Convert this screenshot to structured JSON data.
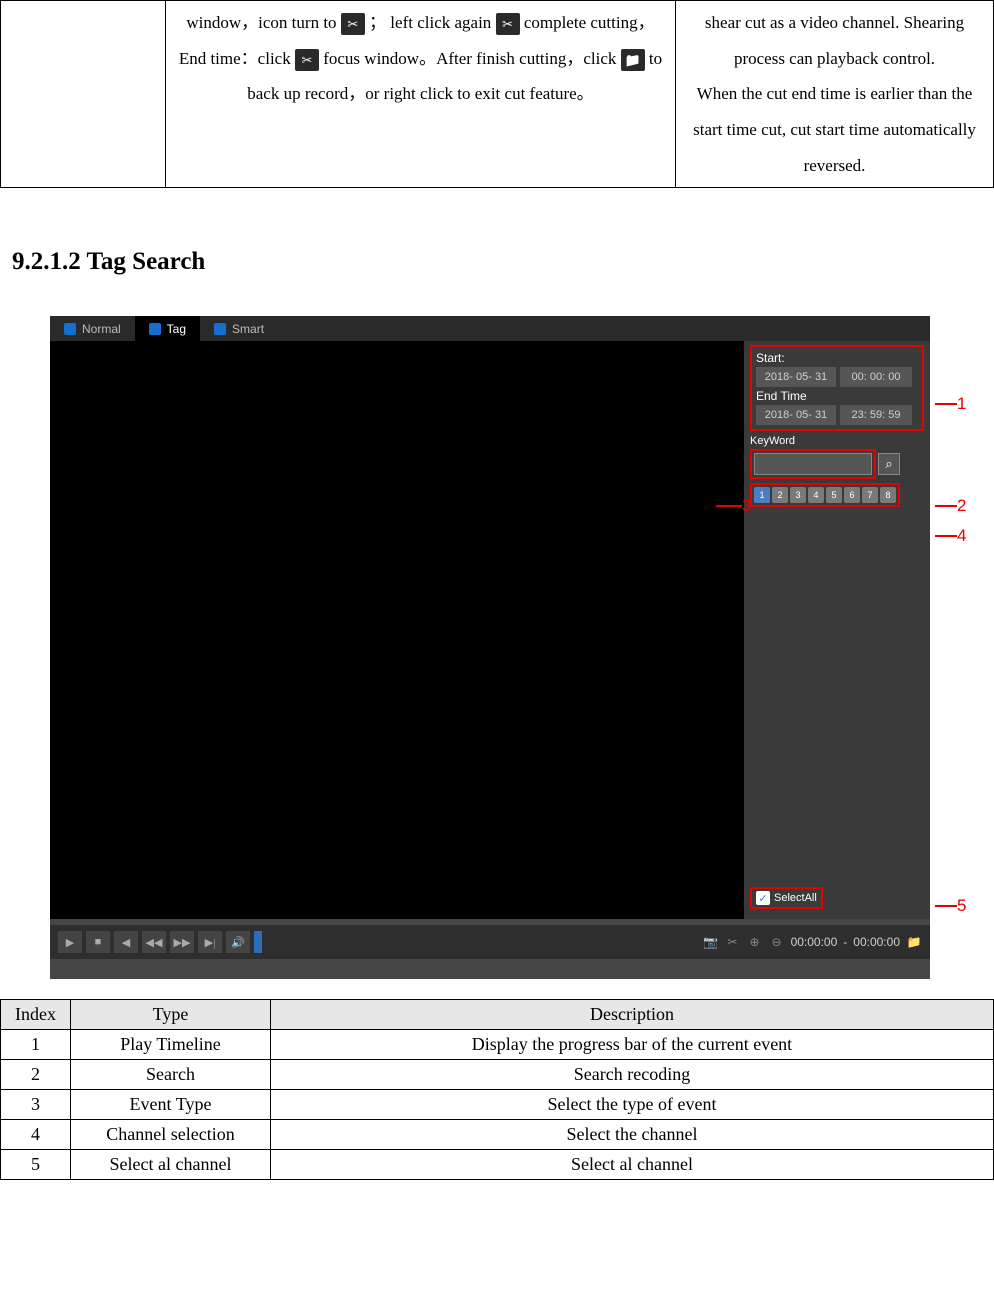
{
  "top_table": {
    "col2_parts": {
      "p1": "window，icon turn to ",
      "p2": "； left click again",
      "p3": "complete cutting，",
      "p4": "End time：click",
      "p5": "focus window。After finish cutting，click",
      "p6": "to back up record，or right click to exit cut feature。"
    },
    "col3": "shear cut as a video channel. Shearing process can playback control.\nWhen the cut end time is earlier than the start time cut, cut start time automatically reversed."
  },
  "heading": "9.2.1.2 Tag Search",
  "tabs": [
    {
      "icon": "normal",
      "label": "Normal"
    },
    {
      "icon": "tag",
      "label": "Tag"
    },
    {
      "icon": "smart",
      "label": "Smart"
    }
  ],
  "sidebar": {
    "start_label": "Start:",
    "start_date": "2018- 05- 31",
    "start_time": "00: 00: 00",
    "end_label": "End Time",
    "end_date": "2018- 05- 31",
    "end_time": "23: 59: 59",
    "keyword_label": "KeyWord",
    "channels": [
      "1",
      "2",
      "3",
      "4",
      "5",
      "6",
      "7",
      "8"
    ],
    "selectall_label": "SelectAll"
  },
  "playbar": {
    "time_left": "00:00:00",
    "time_sep": " - ",
    "time_right": "00:00:00"
  },
  "callouts": {
    "c1": "1",
    "c2": "2",
    "c3": "3",
    "c4": "4",
    "c5": "5"
  },
  "data_table": {
    "headers": [
      "Index",
      "Type",
      "Description"
    ],
    "rows": [
      [
        "1",
        "Play Timeline",
        "Display the progress bar of the current event"
      ],
      [
        "2",
        "Search",
        "Search recoding"
      ],
      [
        "3",
        "Event Type",
        "Select the type of event"
      ],
      [
        "4",
        "Channel selection",
        "Select the channel"
      ],
      [
        "5",
        "Select al channel",
        "Select al channel"
      ]
    ]
  }
}
